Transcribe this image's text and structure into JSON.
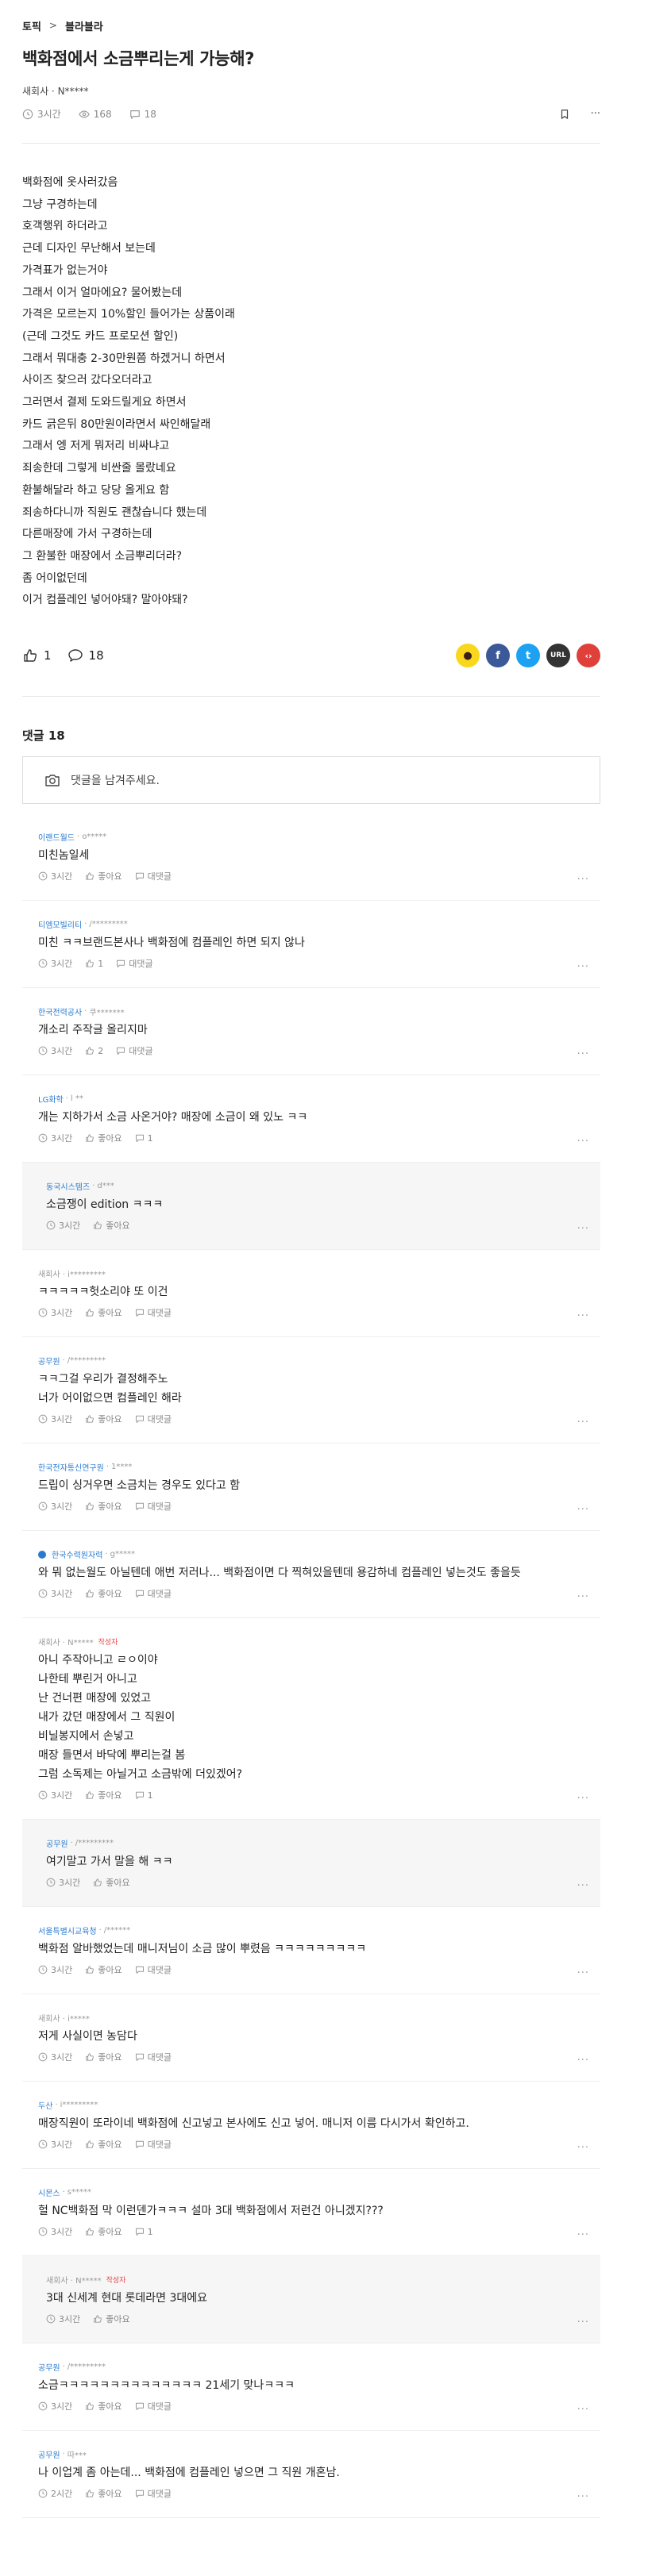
{
  "breadcrumb": {
    "root": "토픽",
    "current": "블라블라"
  },
  "post": {
    "title": "백화점에서 소금뿌리는게 가능해?",
    "author": "새회사 · N*****",
    "time": "3시간",
    "views": "168",
    "comments": "18",
    "body": [
      "백화점에 옷사러갔음",
      "그냥 구경하는데",
      "호객행위 하더라고",
      "근데 디자인 무난해서 보는데",
      "가격표가 없는거야",
      "그래서 이거 얼마에요? 물어봤는데",
      "가격은 모르는지 10%할인 들어가는 상품이래",
      "(근데 그것도 카드 프로모션 할인)",
      "그래서 뭐대충 2-30만원쯤 하겠거니 하면서",
      "사이즈 찾으러 갔다오더라고",
      "그러면서 결제 도와드릴게요 하면서",
      "카드 긁은뒤 80만원이라면서 싸인해달래",
      "그래서 엥 저게 뭐저리 비싸냐고",
      "죄송한데 그렇게 비싼줄 몰랐네요",
      "환불해달라 하고 당당 올게요 함",
      "죄송하다니까 직원도 괜찮습니다 했는데",
      "다른매장에 가서 구경하는데",
      "그 환불한 매장에서 소금뿌리더라?",
      "좀 어이없던데",
      "이거 컴플레인 넣어야돼? 말아야돼?"
    ],
    "likes": "1",
    "reply_count": "18"
  },
  "share": {
    "kakao": "●",
    "facebook": "f",
    "twitter": "t",
    "url": "URL",
    "embed": "‹›"
  },
  "comments_section": {
    "title": "댓글 18",
    "input_placeholder": "댓글을 남겨주세요."
  },
  "labels": {
    "like": "좋아요",
    "reply": "대댓글",
    "more": "···"
  },
  "comments": [
    {
      "company": "이랜드월드",
      "user": "o*****",
      "text": "미친놈일세",
      "time": "3시간",
      "likes": "좋아요",
      "reply": "대댓글"
    },
    {
      "company": "티엠모빌리티",
      "user": "/*********",
      "text": "미친 ㅋㅋ브랜드본사나 백화점에 컴플레인 하면 되지 않나",
      "time": "3시간",
      "likes": "1",
      "reply": "대댓글"
    },
    {
      "company": "한국전력공사",
      "user": "쿠*******",
      "text": "개소리 주작글 올리지마",
      "time": "3시간",
      "likes": "2",
      "reply": "대댓글"
    },
    {
      "company": "LG화학",
      "user": "l **",
      "text": "개는 지하가서 소금 사온거야? 매장에 소금이 왜 있노 ㅋㅋ",
      "time": "3시간",
      "likes": "좋아요",
      "reply": "1"
    },
    {
      "reply_type": true,
      "company": "동국시스템즈",
      "user": "d***",
      "text": "소금쟁이 edition ㅋㅋㅋ",
      "time": "3시간",
      "likes": "좋아요"
    },
    {
      "company": "",
      "user": "새회사 · i*********",
      "text": "ㅋㅋㅋㅋㅋ헛소리야 또 이건",
      "time": "3시간",
      "likes": "좋아요",
      "reply": "대댓글"
    },
    {
      "company": "공무원",
      "user": "/*********",
      "text": "ㅋㅋ그걸 우리가 결정해주노\n너가 어이없으면 컴플레인 해라",
      "time": "3시간",
      "likes": "좋아요",
      "reply": "대댓글"
    },
    {
      "company": "한국전자통신연구원",
      "user": "1****",
      "text": "드립이 싱거우면 소금치는 경우도 있다고 함",
      "time": "3시간",
      "likes": "좋아요",
      "reply": "대댓글"
    },
    {
      "badge": true,
      "company": "한국수력원자력",
      "user": "g*****",
      "text": "와 뭐 없는월도 아닐텐데 애번 저러나... 백화점이면 다 찍혀있을텐데 용감하네 컴플레인 넣는것도 좋을듯",
      "time": "3시간",
      "likes": "좋아요",
      "reply": "대댓글"
    },
    {
      "company": "",
      "user": "새회사 · N*****",
      "op": "작성자",
      "text": "아니 주작아니고 ㄹㅇ이야\n나한테 뿌린거 아니고\n난 건너편 매장에 있었고\n내가 갔던 매장에서 그 직원이\n비닐봉지에서 손넣고\n매장 들면서 바닥에 뿌리는걸 봄\n그럼 소독제는 아닐거고 소금밖에 더있겠어?",
      "time": "3시간",
      "likes": "좋아요",
      "reply": "1"
    },
    {
      "reply_type": true,
      "company": "공무원",
      "user": "/*********",
      "text": "여기말고 가서 말을 해 ㅋㅋ",
      "time": "3시간",
      "likes": "좋아요"
    },
    {
      "company": "서울특별시교육청",
      "user": "/******",
      "text": "백화점 알바했었는데 매니저님이 소금 많이 뿌렸음 ㅋㅋㅋㅋㅋㅋㅋㅋㅋ",
      "time": "3시간",
      "likes": "좋아요",
      "reply": "대댓글"
    },
    {
      "company": "",
      "user": "새회사 · i*****",
      "text": "저게 사실이면 농담다",
      "time": "3시간",
      "likes": "좋아요",
      "reply": "대댓글"
    },
    {
      "company": "두산",
      "user": "i*********",
      "text": "매장직원이 또라이네 백화점에 신고넣고 본사에도 신고 넣어. 매니저 이름 다시가서 확인하고.",
      "time": "3시간",
      "likes": "좋아요",
      "reply": "대댓글"
    },
    {
      "company": "시몬스",
      "user": "s*****",
      "text": "헐 NC백화점 막 이런덴가ㅋㅋㅋ 설마 3대 백화점에서 저런건 아니겠지???",
      "time": "3시간",
      "likes": "좋아요",
      "reply": "1"
    },
    {
      "reply_type": true,
      "company": "",
      "user": "새회사 · N*****",
      "op": "작성자",
      "text": "3대 신세계 현대 롯데라면 3대에요",
      "time": "3시간",
      "likes": "좋아요"
    },
    {
      "company": "공무원",
      "user": "/*********",
      "text": "소금ㅋㅋㅋㅋㅋㅋㅋㅋㅋㅋㅋㅋㅋㅋ 21세기 맞나ㅋㅋㅋ",
      "time": "3시간",
      "likes": "좋아요",
      "reply": "대댓글"
    },
    {
      "company": "공무원",
      "user": "따***",
      "text": "나 이업계 좀 아는데... 백화점에 컴플레인 넣으면 그 직원 개혼남.",
      "time": "2시간",
      "likes": "좋아요",
      "reply": "대댓글"
    }
  ]
}
